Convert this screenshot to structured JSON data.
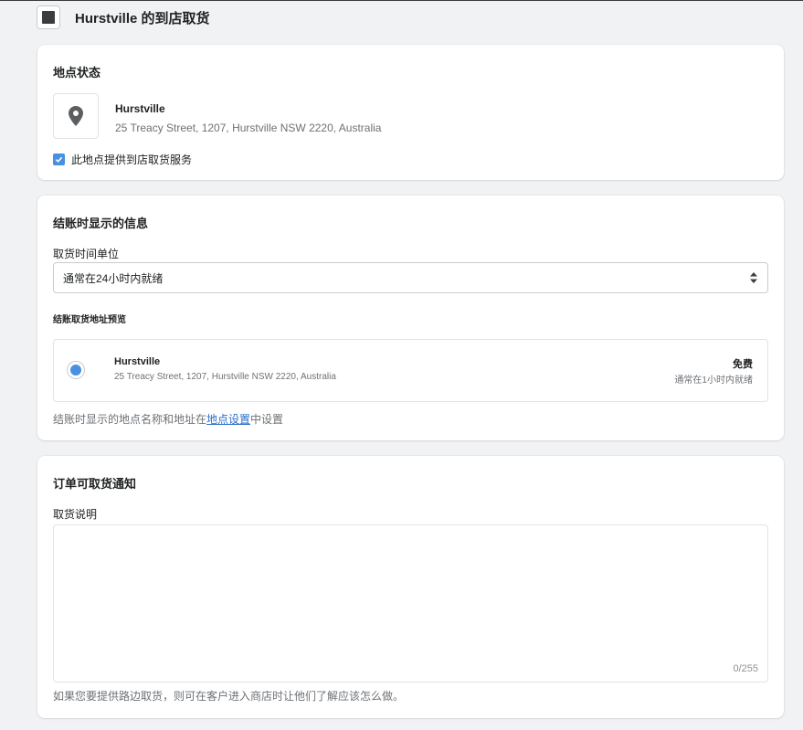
{
  "header": {
    "title": "Hurstville 的到店取货"
  },
  "location_status": {
    "title": "地点状态",
    "location_name": "Hurstville",
    "location_address": "25 Treacy Street, 1207, Hurstville NSW 2220, Australia",
    "pickup_checkbox_label": "此地点提供到店取货服务",
    "pickup_checkbox_checked": true,
    "icon": "location-pin-icon"
  },
  "checkout_info": {
    "title": "结账时显示的信息",
    "pickup_time_label": "取货时间单位",
    "pickup_time_value": "通常在24小时内就绪",
    "preview_title": "结账取货地址预览",
    "preview": {
      "name": "Hurstville",
      "address": "25 Treacy Street, 1207, Hurstville NSW 2220, Australia",
      "price": "免费",
      "ready_time": "通常在1小时内就绪"
    },
    "help_prefix": "结账时显示的地点名称和地址在",
    "help_link": "地点设置",
    "help_suffix": "中设置"
  },
  "pickup_notification": {
    "title": "订单可取货通知",
    "instructions_label": "取货说明",
    "instructions_value": "",
    "char_count": "0/255",
    "help_text": "如果您要提供路边取货，则可在客户进入商店时让他们了解应该怎么做。"
  },
  "colors": {
    "accent": "#4a90e2",
    "link": "#2c6ecb",
    "background": "#f1f2f4"
  }
}
